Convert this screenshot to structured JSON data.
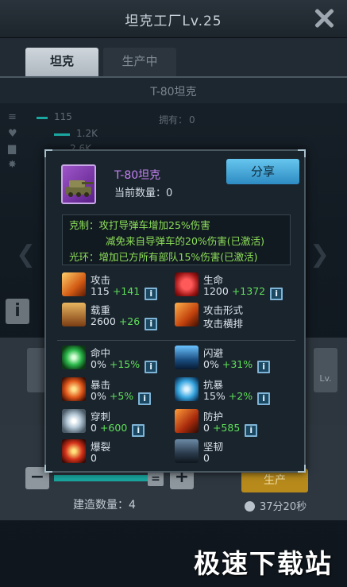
{
  "header": {
    "title": "坦克工厂Lv.25"
  },
  "tabs": [
    {
      "label": "坦克"
    },
    {
      "label": "生产中"
    }
  ],
  "subheader": {
    "title": "T-80坦克"
  },
  "background_stats": [
    {
      "value": "115"
    },
    {
      "value": "1.2K"
    },
    {
      "value": "2.6K"
    }
  ],
  "owned": {
    "label": "拥有：",
    "value": "0"
  },
  "production": {
    "build_count_label": "建造数量：",
    "build_count": "4",
    "produce_label": "生产",
    "timer": "37分20秒",
    "slot_label": "Lv."
  },
  "popup": {
    "tank_name": "T-80坦克",
    "current_qty_label": "当前数量：",
    "current_qty": "0",
    "share_label": "分享",
    "effects": [
      "克制：攻打导弹车增加25%伤害",
      "减免来自导弹车的20%伤害(已激活)",
      "光环：增加已方所有部队15%伤害(已激活)"
    ],
    "stats_primary": [
      {
        "label": "攻击",
        "base": "115",
        "bonus": "+141",
        "icon": "attack-icon",
        "info": true
      },
      {
        "label": "生命",
        "base": "1200",
        "bonus": "+1372",
        "icon": "life-icon",
        "info": true
      },
      {
        "label": "载重",
        "base": "2600",
        "bonus": "+26",
        "icon": "load-icon",
        "info": true
      },
      {
        "label": "攻击形式",
        "base": "攻击横排",
        "bonus": "",
        "icon": "attack-form-icon",
        "info": false
      }
    ],
    "stats_secondary": [
      {
        "label": "命中",
        "base": "0%",
        "bonus": "+15%",
        "icon": "hit-icon",
        "info": true
      },
      {
        "label": "闪避",
        "base": "0%",
        "bonus": "+31%",
        "icon": "dodge-icon",
        "info": true
      },
      {
        "label": "暴击",
        "base": "0%",
        "bonus": "+5%",
        "icon": "crit-icon",
        "info": true
      },
      {
        "label": "抗暴",
        "base": "15%",
        "bonus": "+2%",
        "icon": "anti-crit-icon",
        "info": true
      },
      {
        "label": "穿刺",
        "base": "0",
        "bonus": "+600",
        "icon": "pierce-icon",
        "info": true
      },
      {
        "label": "防护",
        "base": "0",
        "bonus": "+585",
        "icon": "defense-icon",
        "info": true
      },
      {
        "label": "爆裂",
        "base": "0",
        "bonus": "",
        "icon": "burst-icon",
        "info": false
      },
      {
        "label": "坚韧",
        "base": "0",
        "bonus": "",
        "icon": "tough-icon",
        "info": false
      }
    ],
    "info_glyph": "i"
  },
  "watermark": "极速下载站",
  "colors": {
    "accent_green": "#5fe05a",
    "tank_name": "#c382f0",
    "share_button": "#3aa2d8",
    "produce_button": "#b78a1b"
  }
}
